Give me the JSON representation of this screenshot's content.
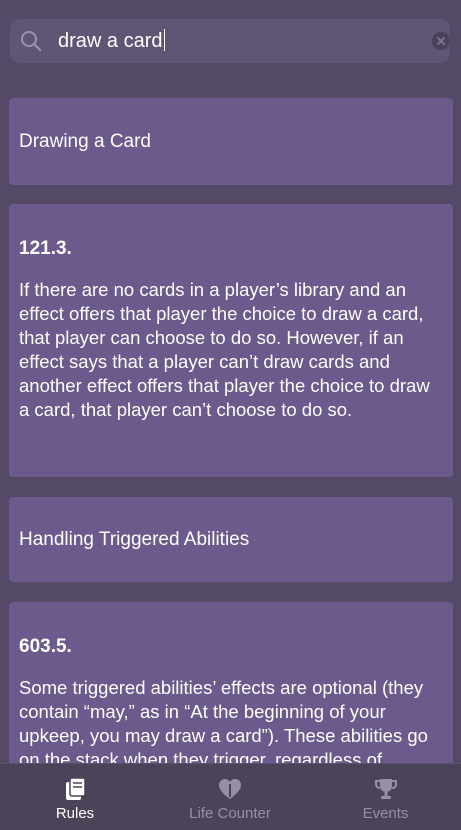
{
  "search": {
    "query": "draw a card",
    "icon": "search-icon",
    "clear_icon": "clear-icon"
  },
  "results": [
    {
      "type": "section",
      "title": "Drawing a Card"
    },
    {
      "type": "rule",
      "number": "121.3.",
      "text": "If there are no cards in a player’s library and an effect offers that player the choice to draw a card, that player can choose to do so. However, if an effect says that a player can’t draw cards and another effect offers that player the choice to draw a card, that player can’t choose to do so."
    },
    {
      "type": "section",
      "title": "Handling Triggered Abilities"
    },
    {
      "type": "rule",
      "number": "603.5.",
      "text": "Some triggered abilities’ effects are optional (they contain “may,” as in “At the beginning of your upkeep, you may draw a card”). These abilities go on the stack when they trigger, regardless of whether their controller intends to exercise the ability’s option or not."
    }
  ],
  "tabs": [
    {
      "label": "Rules",
      "icon": "rules-book-icon",
      "active": true
    },
    {
      "label": "Life Counter",
      "icon": "heart-icon",
      "active": false
    },
    {
      "label": "Events",
      "icon": "trophy-icon",
      "active": false
    }
  ],
  "colors": {
    "background": "#544a68",
    "card": "#6b5a8b",
    "search_field": "#5f5574",
    "tabbar": "#4b4358",
    "tab_active": "#ffffff",
    "tab_inactive": "#968fa6"
  }
}
